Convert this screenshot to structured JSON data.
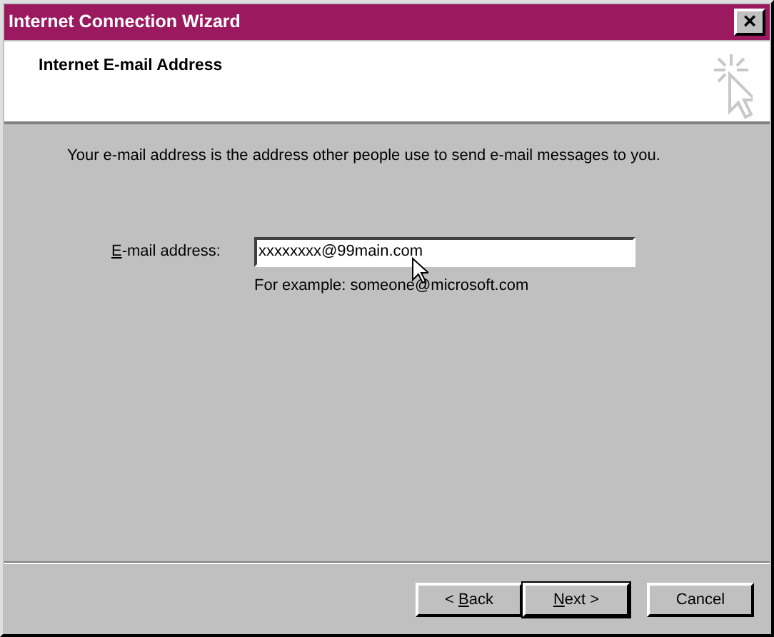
{
  "window": {
    "title": "Internet Connection Wizard",
    "close": "×"
  },
  "header": {
    "title": "Internet E-mail Address"
  },
  "intro": "Your e-mail address is the address other people use to send e-mail messages to you.",
  "email_field": {
    "label": {
      "key": "E",
      "after": "-mail address:"
    },
    "value": "xxxxxxxx@99main.com",
    "focused": true
  },
  "example": "For example: someone@microsoft.com",
  "buttons": [
    {
      "label": {
        "before": "< ",
        "key": "B",
        "after": "ack"
      },
      "default": false
    },
    {
      "label": {
        "key": "N",
        "after": "ext >"
      },
      "default": true
    },
    {
      "label": {
        "before": "Cancel"
      },
      "default": false
    }
  ]
}
